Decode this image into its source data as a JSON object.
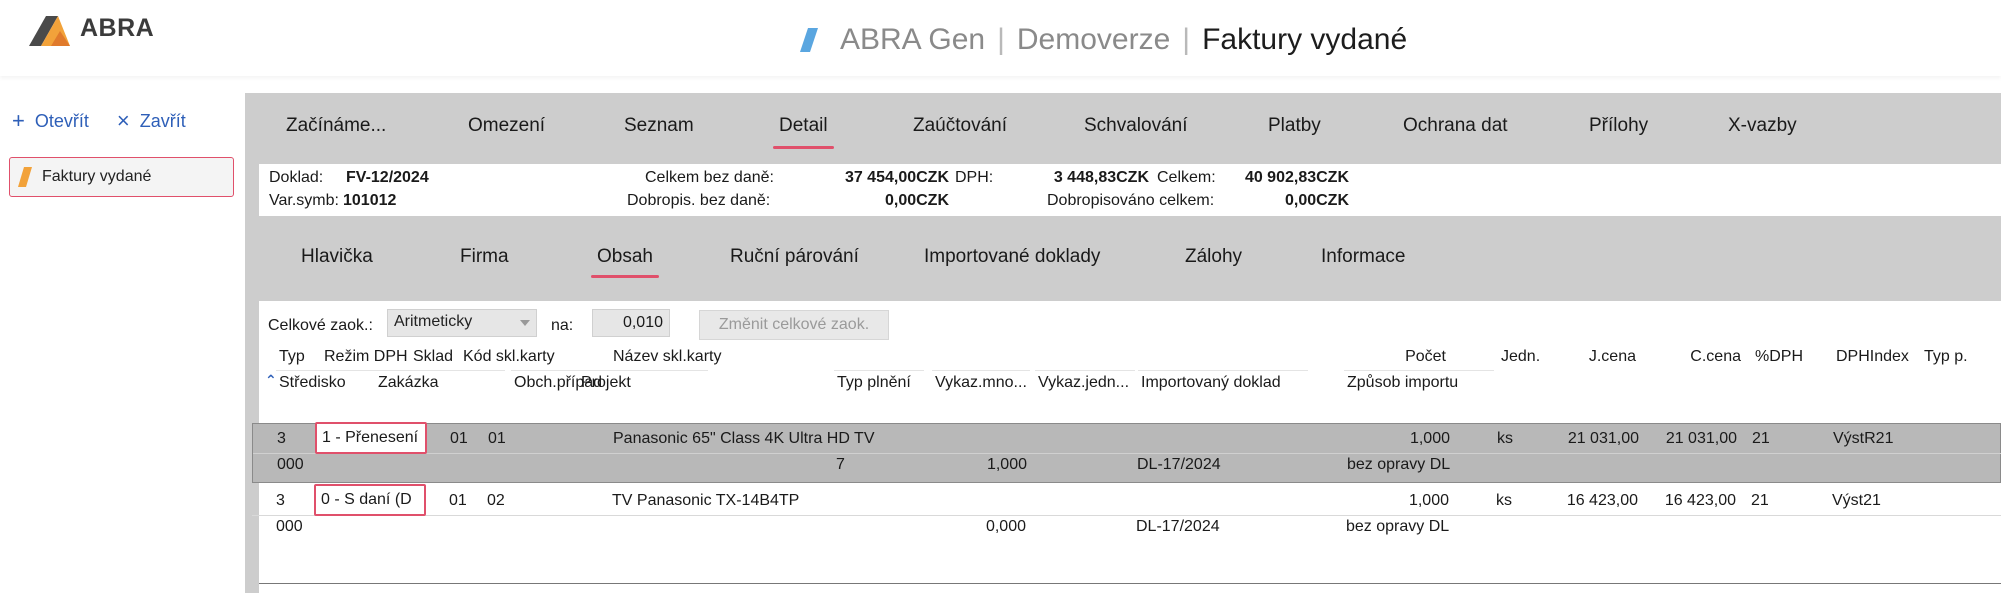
{
  "brand": {
    "logo_text": "ABRA"
  },
  "title": {
    "app": "ABRA Gen",
    "edition": "Demoverze",
    "agenda": "Faktury vydané",
    "separator": "|"
  },
  "left": {
    "open_label": "Otevřít",
    "close_label": "Zavřít",
    "open_icon": "+",
    "close_icon": "×",
    "doc_item": "Faktury vydané"
  },
  "tabs": [
    "Začínáme...",
    "Omezení",
    "Seznam",
    "Detail",
    "Zaúčtování",
    "Schvalování",
    "Platby",
    "Ochrana dat",
    "Přílohy",
    "X-vazby"
  ],
  "active_tab": "Detail",
  "summary": {
    "doklad_label": "Doklad:",
    "doklad_value": "FV-12/2024",
    "varsymb_label": "Var.symb:",
    "varsymb_value": "101012",
    "celkem_bez_dane_label": "Celkem bez daně:",
    "celkem_bez_dane_value": "37 454,00CZK",
    "dph_label": "DPH:",
    "dph_value": "3 448,83CZK",
    "celkem_label": "Celkem:",
    "celkem_value": "40 902,83CZK",
    "dobropis_label": "Dobropis. bez daně:",
    "dobropis_value": "0,00CZK",
    "dobropisovano_label": "Dobropisováno celkem:",
    "dobropisovano_value": "0,00CZK"
  },
  "subtabs": [
    "Hlavička",
    "Firma",
    "Obsah",
    "Ruční párování",
    "Importované doklady",
    "Zálohy",
    "Informace"
  ],
  "active_subtab": "Obsah",
  "rounding": {
    "label": "Celkové zaok.:",
    "select_value": "Aritmeticky",
    "na_label": "na:",
    "na_value": "0,010",
    "change_button": "Změnit celkové zaok."
  },
  "columns_row1": [
    "Typ",
    "Režim DPH",
    "Sklad",
    "Kód skl.karty",
    "Název skl.karty",
    "Počet",
    "Jedn.",
    "J.cena",
    "C.cena",
    "%DPH",
    "DPHIndex",
    "Typ p."
  ],
  "columns_row2": [
    "Středisko",
    "Zakázka",
    "Obch.případ",
    "Projekt",
    "Typ plnění",
    "Vykaz.mno...",
    "Vykaz.jedn...",
    "Importovaný doklad",
    "Způsob importu"
  ],
  "rows": [
    {
      "typ": "3",
      "rezim": "1 - Přenesení",
      "sklad": "01",
      "kod": "01",
      "nazev": "Panasonic 65\" Class 4K Ultra HD TV",
      "pocet": "1,000",
      "jedn": "ks",
      "jcena": "21 031,00",
      "ccena": "21 031,00",
      "dph": "21",
      "dphindex": "VýstR21",
      "typp": "",
      "stredisko": "000",
      "zakazka": "",
      "obch": "",
      "projekt": "",
      "typplneni": "7",
      "vykazmno": "1,000",
      "vykazjedn": "",
      "importdoc": "DL-17/2024",
      "zpusob": "bez opravy DL"
    },
    {
      "typ": "3",
      "rezim": "0 - S daní (D",
      "sklad": "01",
      "kod": "02",
      "nazev": "TV Panasonic TX-14B4TP",
      "pocet": "1,000",
      "jedn": "ks",
      "jcena": "16 423,00",
      "ccena": "16 423,00",
      "dph": "21",
      "dphindex": "Výst21",
      "typp": "",
      "stredisko": "000",
      "zakazka": "",
      "obch": "",
      "projekt": "",
      "typplneni": "",
      "vykazmno": "0,000",
      "vykazjedn": "",
      "importdoc": "DL-17/2024",
      "zpusob": "bez opravy DL"
    }
  ],
  "colors": {
    "accent": "#e0506b",
    "link": "#2e5fb8",
    "logo_orange": "#f2a23a",
    "logo_gray": "#4a4a4a",
    "title_blue": "#5aa6e0"
  }
}
